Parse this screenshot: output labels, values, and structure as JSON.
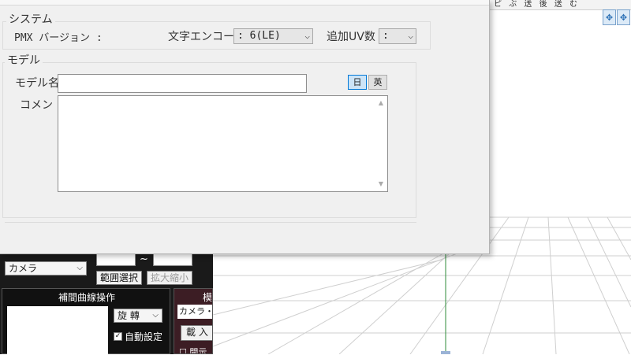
{
  "dialog": {
    "system_group": {
      "title": "システム",
      "pmx_version_label": "PMX バージョン :",
      "encode_label": "文字エンコード",
      "encode_value": ": 6(LE)",
      "uv_label": "追加UV数",
      "uv_value": ":"
    },
    "model_group": {
      "title": "モデル",
      "name_label": "モデル名",
      "name_value": "",
      "lang_jp": "日",
      "lang_en": "英",
      "comment_label": "コメン",
      "comment_value": ""
    }
  },
  "viewport": {
    "toolbar_items": [
      "ピ",
      "ぶ",
      "送",
      "後",
      "送",
      "む"
    ]
  },
  "mmd_panel": {
    "camera_select": "カメラ",
    "frame_range_tilde": "~",
    "range_select_button": "範囲選択",
    "zoom_button": "拡大縮小",
    "interp_title": "補間曲線操作",
    "rotation_select": "旋 轉",
    "auto_set_label": "自動設定",
    "auto_set_checked": true,
    "model_panel_title": "模",
    "model_select": "カメラ・照明",
    "load_button": "載 入",
    "open_checkbox": "開示"
  },
  "colors": {
    "dialog_bg": "#f0f0f0",
    "dark_panel": "#1a1a1a",
    "model_panel": "#3c1d24",
    "accent_blue": "#0078d7"
  }
}
